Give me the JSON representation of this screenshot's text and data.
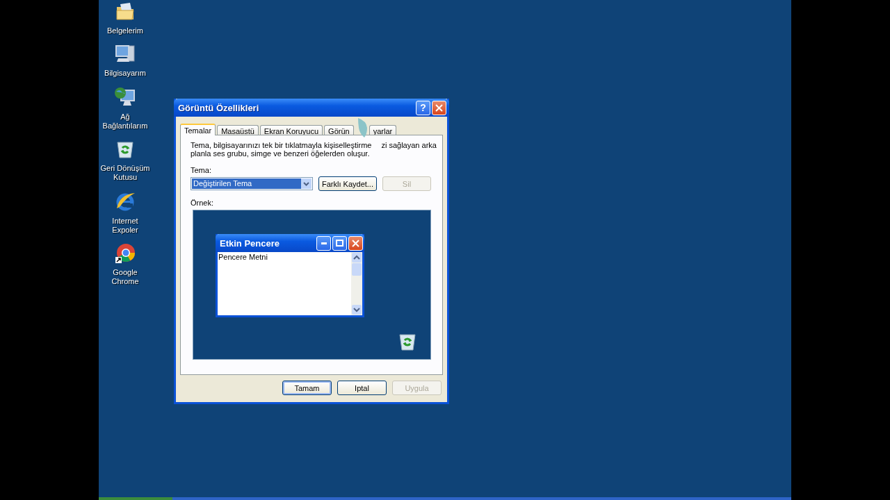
{
  "desktop": {
    "icons": [
      {
        "label": "Belgelerim",
        "kind": "folder"
      },
      {
        "label": "Bilgisayarım",
        "kind": "computer"
      },
      {
        "label": "Ağ Bağlantılarım",
        "kind": "network"
      },
      {
        "label": "Geri Dönüşüm Kutusu",
        "kind": "recycle"
      },
      {
        "label": "Internet Expoler",
        "kind": "ie"
      },
      {
        "label": "Google Chrome",
        "kind": "chrome"
      }
    ]
  },
  "dialog": {
    "title": "Görüntü Özellikleri",
    "help_button": "?",
    "tabs": [
      {
        "label": "Temalar",
        "selected": true
      },
      {
        "label": "Masaüstü",
        "selected": false
      },
      {
        "label": "Ekran Koruyucu",
        "selected": false
      },
      {
        "label": "Görün",
        "selected": false
      },
      {
        "label": "yarlar",
        "selected": false
      }
    ],
    "description": [
      "Tema, bilgisayarınızı tek bir tıklatmayla kişiselleştirme",
      "zi sağlayan arka",
      "planla ses grubu, simge ve benzeri öğelerden oluşur."
    ],
    "theme_label": "Tema:",
    "theme_value": "Değiştirilen Tema",
    "theme_buttons": [
      {
        "label": "Farklı Kaydet...",
        "disabled": false
      },
      {
        "label": "Sil",
        "disabled": true
      }
    ],
    "preview_label": "Örnek:",
    "preview": {
      "window_title": "Etkin Pencere",
      "window_text": "Pencere Metni"
    },
    "buttons": [
      {
        "label": "Tamam",
        "disabled": false,
        "default": true
      },
      {
        "label": "Iptal",
        "disabled": false,
        "default": false
      },
      {
        "label": "Uygula",
        "disabled": true,
        "default": false
      }
    ]
  }
}
